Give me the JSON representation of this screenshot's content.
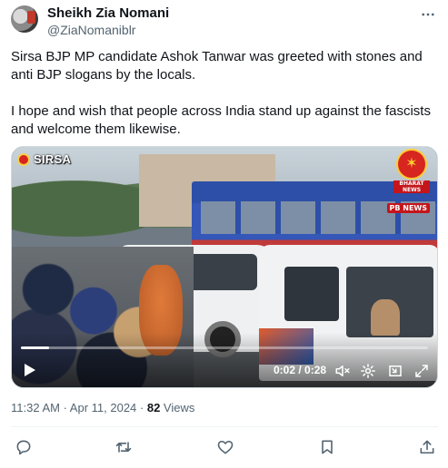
{
  "author": {
    "display_name": "Sheikh Zia Nomani",
    "handle": "@ZiaNomaniblr",
    "avatar_icon": "user-avatar"
  },
  "tweet": {
    "paragraphs": [
      "Sirsa BJP MP candidate Ashok Tanwar was greeted with stones and anti BJP slogans by the locals.",
      "I hope and wish that people across India stand up against the fascists and welcome them likewise."
    ]
  },
  "video": {
    "overlay_left": "SIRSA",
    "overlay_right_line1": "BHARAT",
    "overlay_right_line2": "NEWS",
    "overlay_badge": "PB NEWS",
    "time": "0:02 / 0:28",
    "progress": 0.07,
    "icons": {
      "play": "play-icon",
      "mute": "volume-mute-icon",
      "settings": "gear-icon",
      "pip": "picture-in-picture-icon",
      "fullscreen": "fullscreen-icon"
    }
  },
  "meta": {
    "time": "11:32 AM · Apr 11, 2024 · ",
    "views_count": "82",
    "views_label": " Views"
  },
  "actions": {
    "icons": [
      "reply-icon",
      "retweet-icon",
      "like-icon",
      "bookmark-icon",
      "share-icon"
    ]
  },
  "colors": {
    "text": "#0f1419",
    "secondary": "#536471",
    "divider": "#eff3f4"
  }
}
